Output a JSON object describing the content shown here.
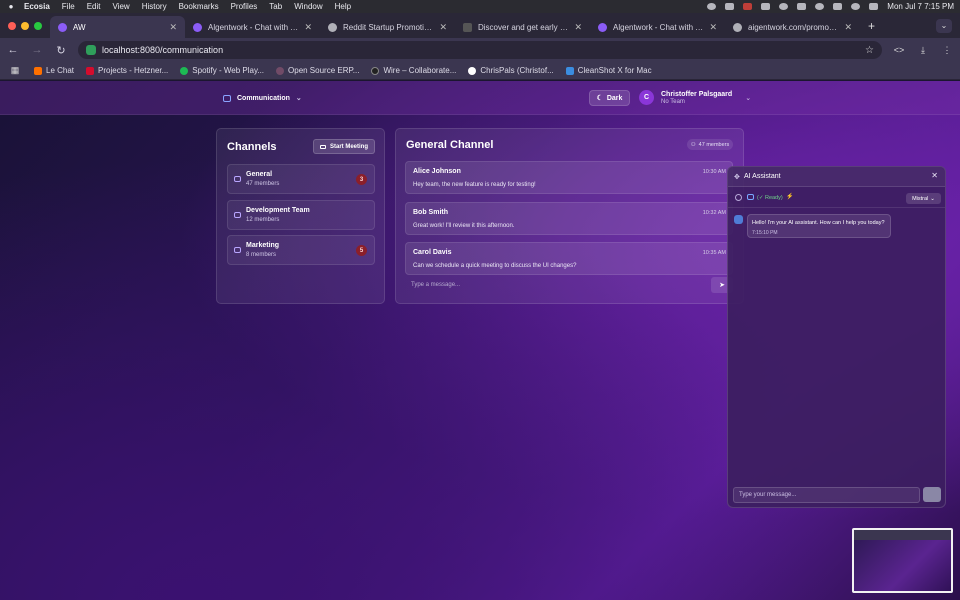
{
  "menubar": {
    "app": "Ecosia",
    "items": [
      "File",
      "Edit",
      "View",
      "History",
      "Bookmarks",
      "Profiles",
      "Tab",
      "Window",
      "Help"
    ],
    "datetime": "Mon Jul 7  7:15 PM"
  },
  "tabs": [
    {
      "title": "AW",
      "favicon": "purple"
    },
    {
      "title": "Algentwork - Chat with Your",
      "favicon": "purple"
    },
    {
      "title": "Reddit Startup Promotion Tip",
      "favicon": "gray"
    },
    {
      "title": "Discover and get early access",
      "favicon": "dark"
    },
    {
      "title": "Algentwork - Chat with Your",
      "favicon": "purple"
    },
    {
      "title": "aigentwork.com/promo-video",
      "favicon": "gray"
    }
  ],
  "url": "localhost:8080/communication",
  "bookmarks": [
    {
      "label": "Le Chat",
      "color": "#ff7000"
    },
    {
      "label": "Projects - Hetzner...",
      "color": "#d50c2d"
    },
    {
      "label": "Spotify - Web Play...",
      "color": "#1db954"
    },
    {
      "label": "Open Source ERP...",
      "color": "#714b67"
    },
    {
      "label": "Wire – Collaborate...",
      "color": "#222222"
    },
    {
      "label": "ChrisPals (Christof...",
      "color": "#ffffff"
    },
    {
      "label": "CleanShot X for Mac",
      "color": "#3b8de0"
    }
  ],
  "header": {
    "nav_label": "Communication",
    "theme_label": "Dark",
    "user": {
      "initial": "C",
      "name": "Christoffer Palsgaard",
      "team": "No Team"
    }
  },
  "channels": {
    "title": "Channels",
    "start_meeting": "Start Meeting",
    "items": [
      {
        "name": "General",
        "members": "47 members",
        "badge": "3"
      },
      {
        "name": "Development Team",
        "members": "12 members",
        "badge": ""
      },
      {
        "name": "Marketing",
        "members": "8 members",
        "badge": "5"
      }
    ]
  },
  "general": {
    "title": "General Channel",
    "members": "47 members",
    "messages": [
      {
        "author": "Alice Johnson",
        "time": "10:30 AM",
        "text": "Hey team, the new feature is ready for testing!"
      },
      {
        "author": "Bob Smith",
        "time": "10:32 AM",
        "text": "Great work! I'll review it this afternoon."
      },
      {
        "author": "Carol Davis",
        "time": "10:35 AM",
        "text": "Can we schedule a quick meeting to discuss the UI changes?"
      }
    ],
    "input_placeholder": "Type a message..."
  },
  "ai": {
    "title": "AI Assistant",
    "status": "(✓ Ready)",
    "model": "Mistral",
    "greeting": "Hello! I'm your AI assistant. How can I help you today?",
    "greeting_time": "7:15:10 PM",
    "input_placeholder": "Type your message..."
  }
}
